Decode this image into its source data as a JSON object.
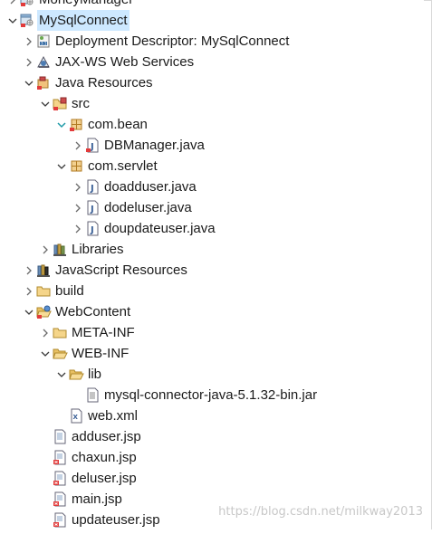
{
  "tree": [
    {
      "label": "MoneyManager",
      "depth": 0,
      "toggle": "right",
      "icon": "project-icon"
    },
    {
      "label": "MySqlConnect",
      "depth": 0,
      "toggle": "down",
      "icon": "project-icon",
      "selected": true
    },
    {
      "label": "Deployment Descriptor: MySqlConnect",
      "depth": 1,
      "toggle": "right",
      "icon": "deployment-descriptor-icon"
    },
    {
      "label": "JAX-WS Web Services",
      "depth": 1,
      "toggle": "right",
      "icon": "web-services-icon"
    },
    {
      "label": "Java Resources",
      "depth": 1,
      "toggle": "down",
      "icon": "java-resources-icon"
    },
    {
      "label": "src",
      "depth": 2,
      "toggle": "down",
      "icon": "source-folder-icon"
    },
    {
      "label": "com.bean",
      "depth": 3,
      "toggle": "down-teal",
      "icon": "package-error-icon"
    },
    {
      "label": "DBManager.java",
      "depth": 4,
      "toggle": "right",
      "icon": "java-file-error-icon"
    },
    {
      "label": "com.servlet",
      "depth": 3,
      "toggle": "down",
      "icon": "package-icon"
    },
    {
      "label": "doadduser.java",
      "depth": 4,
      "toggle": "right",
      "icon": "java-file-icon"
    },
    {
      "label": "dodeluser.java",
      "depth": 4,
      "toggle": "right",
      "icon": "java-file-icon"
    },
    {
      "label": "doupdateuser.java",
      "depth": 4,
      "toggle": "right",
      "icon": "java-file-icon"
    },
    {
      "label": "Libraries",
      "depth": 2,
      "toggle": "right",
      "icon": "libraries-icon"
    },
    {
      "label": "JavaScript Resources",
      "depth": 1,
      "toggle": "right",
      "icon": "javascript-resources-icon"
    },
    {
      "label": "build",
      "depth": 1,
      "toggle": "right",
      "icon": "folder-icon"
    },
    {
      "label": "WebContent",
      "depth": 1,
      "toggle": "down",
      "icon": "webcontent-folder-icon"
    },
    {
      "label": "META-INF",
      "depth": 2,
      "toggle": "right",
      "icon": "folder-icon"
    },
    {
      "label": "WEB-INF",
      "depth": 2,
      "toggle": "down",
      "icon": "folder-open-icon"
    },
    {
      "label": "lib",
      "depth": 3,
      "toggle": "down",
      "icon": "folder-open-icon"
    },
    {
      "label": "mysql-connector-java-5.1.32-bin.jar",
      "depth": 4,
      "toggle": "none",
      "icon": "jar-file-icon"
    },
    {
      "label": "web.xml",
      "depth": 3,
      "toggle": "none",
      "icon": "xml-file-icon"
    },
    {
      "label": "adduser.jsp",
      "depth": 2,
      "toggle": "none",
      "icon": "jsp-file-icon"
    },
    {
      "label": "chaxun.jsp",
      "depth": 2,
      "toggle": "none",
      "icon": "jsp-file-error-icon"
    },
    {
      "label": "deluser.jsp",
      "depth": 2,
      "toggle": "none",
      "icon": "jsp-file-error-icon"
    },
    {
      "label": "main.jsp",
      "depth": 2,
      "toggle": "none",
      "icon": "jsp-file-error-icon"
    },
    {
      "label": "updateuser.jsp",
      "depth": 2,
      "toggle": "none",
      "icon": "jsp-file-error-icon"
    }
  ],
  "watermark": "https://blog.csdn.net/milkway2013"
}
